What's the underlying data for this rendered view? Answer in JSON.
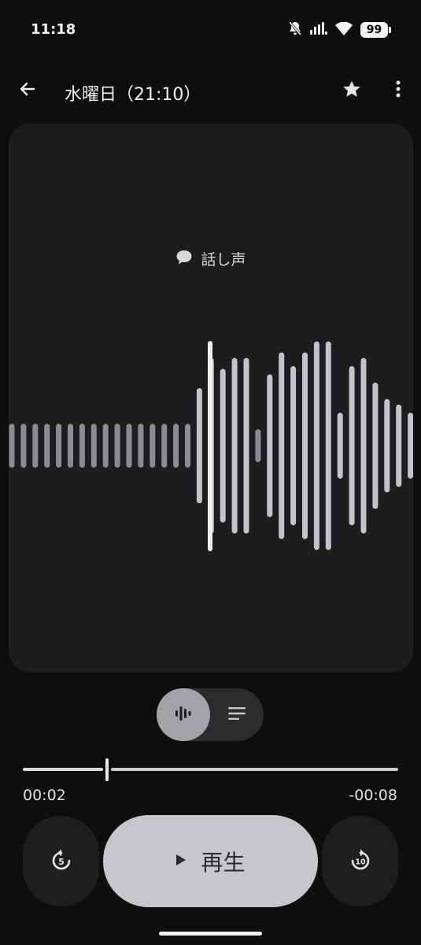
{
  "status_bar": {
    "time": "11:18",
    "battery": "99",
    "icons": [
      "mute-icon",
      "signal-icon",
      "wifi-icon",
      "battery-icon"
    ]
  },
  "app_bar": {
    "title": "水曜日（21:10）",
    "icons": [
      "back-arrow-icon",
      "star-icon",
      "more-vert-icon"
    ]
  },
  "waveform": {
    "speaker_label": "話し声",
    "bars": [
      0.08,
      0.08,
      0.08,
      0.08,
      0.08,
      0.08,
      0.08,
      0.08,
      0.08,
      0.08,
      0.08,
      0.08,
      0.08,
      0.08,
      0.08,
      0.08,
      0.21,
      0.32,
      0.28,
      0.32,
      0.32,
      0.06,
      0.26,
      0.34,
      0.29,
      0.34,
      0.38,
      0.38,
      0.12,
      0.29,
      0.32,
      0.23,
      0.17,
      0.15,
      0.12,
      0.1
    ],
    "playhead_position": 0.2
  },
  "view_toggle": {
    "selected": "waveform",
    "icons": [
      "waveform-icon",
      "transcript-icon"
    ]
  },
  "playback": {
    "elapsed": "00:02",
    "remaining": "-00:08",
    "progress": 0.2,
    "play_label": "再生",
    "rewind_seconds": "5",
    "forward_seconds": "10"
  },
  "colors": {
    "background": "#0e0e0f",
    "card": "#1d1d1f",
    "accent": "#c6c6cb"
  }
}
